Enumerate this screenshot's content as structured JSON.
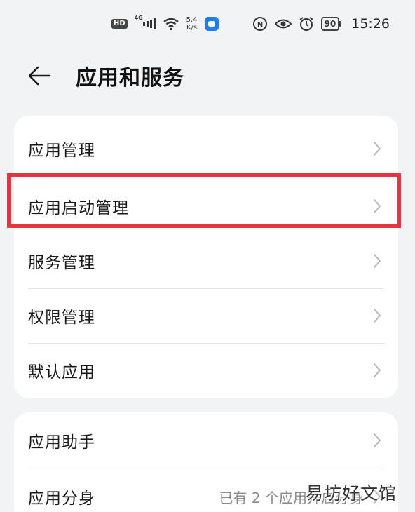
{
  "status_bar": {
    "hd": "HD",
    "network": "4G",
    "speed_value": "5.4",
    "speed_unit": "K/s",
    "battery": "90",
    "time": "15:26"
  },
  "header": {
    "title": "应用和服务"
  },
  "card_1": {
    "items": [
      {
        "label": "应用管理"
      },
      {
        "label": "应用启动管理"
      },
      {
        "label": "服务管理"
      },
      {
        "label": "权限管理"
      },
      {
        "label": "默认应用"
      }
    ]
  },
  "card_2": {
    "items": [
      {
        "label": "应用助手",
        "value": ""
      },
      {
        "label": "应用分身",
        "value": "已有 2 个应用开启分身"
      }
    ]
  },
  "watermark": "易坊好文馆",
  "colors": {
    "background": "#f1f3f5",
    "card": "#ffffff",
    "highlight": "#e8343a",
    "secondary_text": "#8a8a8a"
  }
}
